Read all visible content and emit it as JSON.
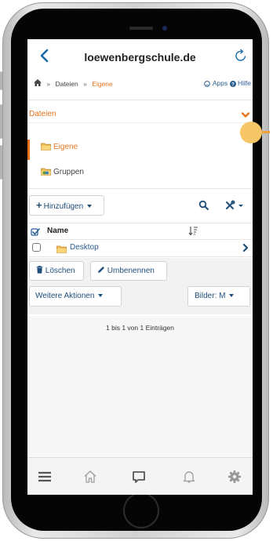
{
  "header": {
    "title": "loewenbergschule.de"
  },
  "breadcrumb": {
    "items": [
      "Dateien",
      "Eigene"
    ],
    "separator": "»",
    "apps_label": "Apps",
    "help_label": "Hilfe"
  },
  "panel": {
    "title": "Dateien",
    "items": [
      {
        "label": "Eigene",
        "active": true
      },
      {
        "label": "Gruppen",
        "active": false
      }
    ]
  },
  "toolbar": {
    "add_label": "Hinzufügen"
  },
  "table": {
    "column_name": "Name",
    "rows": [
      {
        "name": "Desktop"
      }
    ]
  },
  "actions": {
    "delete_label": "Löschen",
    "rename_label": "Umbenennen",
    "more_label": "Weitere Aktionen",
    "images_label": "Bilder: M"
  },
  "status": {
    "count_text": "1 bis 1 von 1 Einträgen"
  },
  "colors": {
    "accent": "#e8731c",
    "link": "#1f4e7a",
    "marker": "#f7c667"
  },
  "icons": [
    "back-icon",
    "reload-icon",
    "home-icon",
    "smiley-icon",
    "help-icon",
    "chevron-down-icon",
    "folder-icon",
    "plus-icon",
    "search-icon",
    "tools-icon",
    "check-icon",
    "sort-icon",
    "trash-icon",
    "pencil-icon",
    "menu-icon",
    "house-icon",
    "chat-icon",
    "bell-icon",
    "gear-icon"
  ]
}
